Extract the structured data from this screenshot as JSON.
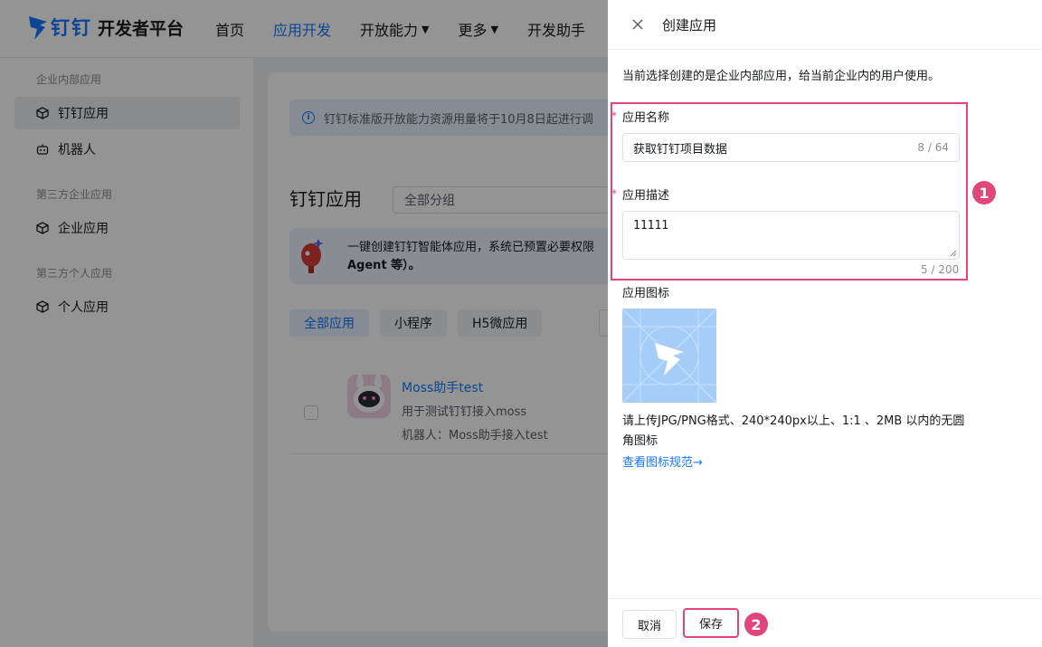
{
  "header": {
    "brand": "钉钉",
    "product": "开发者平台",
    "nav": [
      {
        "label": "首页"
      },
      {
        "label": "应用开发"
      },
      {
        "label": "开放能力"
      },
      {
        "label": "更多"
      },
      {
        "label": "开发助手"
      }
    ]
  },
  "sidebar": {
    "groups": [
      {
        "label": "企业内部应用"
      },
      {
        "label": "第三方企业应用"
      },
      {
        "label": "第三方个人应用"
      }
    ],
    "items": [
      {
        "label": "钉钉应用"
      },
      {
        "label": "机器人"
      },
      {
        "label": "企业应用"
      },
      {
        "label": "个人应用"
      }
    ]
  },
  "main": {
    "notice": "钉钉标准版开放能力资源用量将于10月8日起进行调",
    "section_title": "钉钉应用",
    "group_select": "全部分组",
    "banner_line1": "一键创建钉钉智能体应用，系统已预置必要权限",
    "banner_line2": "Agent 等）。",
    "filters": [
      {
        "label": "全部应用"
      },
      {
        "label": "小程序"
      },
      {
        "label": "H5微应用"
      }
    ],
    "app": {
      "name": "Moss助手test",
      "desc": "用于测试钉钉接入moss",
      "bot": "机器人：Moss助手接入test"
    }
  },
  "drawer": {
    "title": "创建应用",
    "hint": "当前选择创建的是企业内部应用，给当前企业内的用户使用。",
    "required_mark": "*",
    "name_label": "应用名称",
    "name_value": "获取钉钉项目数据",
    "name_count": "8 / 64",
    "desc_label": "应用描述",
    "desc_value": "11111",
    "desc_count": "5 / 200",
    "icon_label": "应用图标",
    "upload_tip": "请上传JPG/PNG格式、240*240px以上、1:1 、2MB 以内的无圆角图标",
    "spec_link": "查看图标规范→",
    "cancel": "取消",
    "save": "保存"
  },
  "annotations": {
    "badge1": "1",
    "badge2": "2",
    "color": "#e0457b"
  },
  "colors": {
    "accent": "#1677ff",
    "overlay": "rgba(0,0,0,0.42)"
  }
}
